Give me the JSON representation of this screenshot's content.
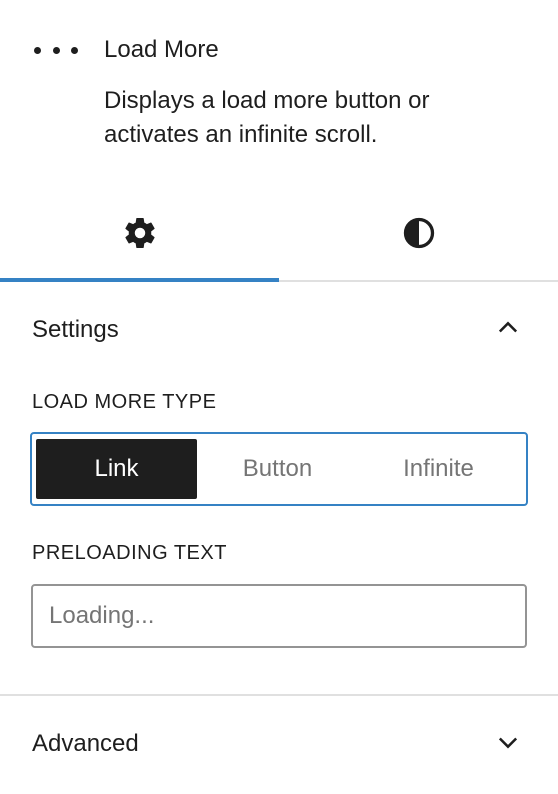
{
  "block": {
    "icon": "ellipsis-icon",
    "title": "Load More",
    "description": "Displays a load more button or activates an infinite scroll."
  },
  "tabs": [
    {
      "name": "settings",
      "icon": "gear-icon",
      "active": true
    },
    {
      "name": "styles",
      "icon": "contrast-icon",
      "active": false
    }
  ],
  "settings": {
    "title": "Settings",
    "expanded": true,
    "load_more_type_label": "LOAD MORE TYPE",
    "options": [
      "Link",
      "Button",
      "Infinite"
    ],
    "selected_option": "Link",
    "preloading_text_label": "PRELOADING TEXT",
    "preloading_text_value": "",
    "preloading_text_placeholder": "Loading..."
  },
  "advanced": {
    "title": "Advanced",
    "expanded": false
  },
  "colors": {
    "accent": "#3582c4",
    "text": "#1e1e1e",
    "muted": "#757575",
    "border": "#949494",
    "divider": "#e0e0e0"
  }
}
